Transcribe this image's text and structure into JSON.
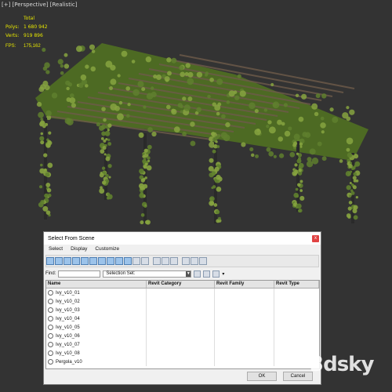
{
  "viewport": {
    "label": "[+] [Perspective] [Realistic]",
    "stats_header": "Total",
    "polys_label": "Polys:",
    "polys_value": "1 680 942",
    "verts_label": "Verts:",
    "verts_value": "919 896",
    "fps_label": "FPS:",
    "fps_value": "175,162"
  },
  "dialog": {
    "title": "Select From Scene",
    "close_glyph": "x",
    "menu": [
      "Select",
      "Display",
      "Customize"
    ],
    "find_label": "Find:",
    "selection_set_label": "Selection Set:",
    "columns": [
      "Name",
      "Revit Category",
      "Revit Family",
      "Revit Type"
    ],
    "rows": [
      "Ivy_v10_01",
      "Ivy_v10_02",
      "Ivy_v10_03",
      "Ivy_v10_04",
      "Ivy_v10_05",
      "Ivy_v10_06",
      "Ivy_v10_07",
      "Ivy_v10_08",
      "Pergola_v10"
    ],
    "ok_label": "OK",
    "cancel_label": "Cancel"
  },
  "watermark": "3dsky",
  "colors": {
    "viewport_bg": "#333333",
    "stats_text": "#e6e600",
    "ivy_green": "#5f7f2e",
    "wood": "#6e5b4a"
  }
}
